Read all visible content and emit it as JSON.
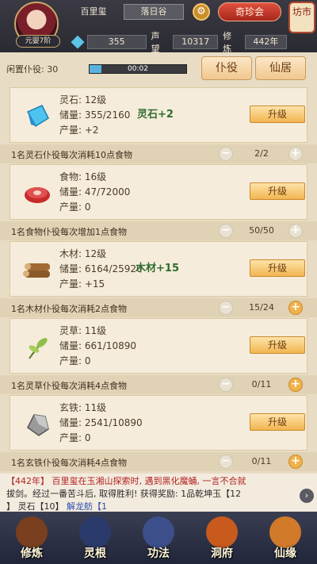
{
  "header": {
    "badge": "元婴7阶",
    "player_name": "百里玺",
    "location": "落日谷",
    "treasure_label": "奇珍会",
    "shop_label": "坊市",
    "gems": "355",
    "reputation_label": "声望",
    "reputation": "10317",
    "cultivation_label": "修炼",
    "cultivation_years": "442年"
  },
  "servants": {
    "label": "闲置仆役: 30",
    "timer": "00:02",
    "progress_fraction": 0.12,
    "tab_servant": "仆役",
    "tab_residence": "仙居"
  },
  "resources": [
    {
      "icon": "spirit-stone-icon",
      "name": "灵石: 12级",
      "storage": "储量: 355/2160",
      "output": "产量: +2",
      "float": "灵石+2",
      "upgrade": "升级",
      "worker_text": "1名灵石仆役每次消耗10点食物",
      "count": "2/2",
      "plus_active": false
    },
    {
      "icon": "food-icon",
      "name": "食物: 16级",
      "storage": "储量: 47/72000",
      "output": "产量: 0",
      "float": "",
      "upgrade": "升级",
      "worker_text": "1名食物仆役每次增加1点食物",
      "count": "50/50",
      "plus_active": false
    },
    {
      "icon": "wood-icon",
      "name": "木材: 12级",
      "storage": "储量: 6164/25920",
      "output": "产量: +15",
      "float": "木材+15",
      "upgrade": "升级",
      "worker_text": "1名木材仆役每次消耗2点食物",
      "count": "15/24",
      "plus_active": true
    },
    {
      "icon": "herb-icon",
      "name": "灵草: 11级",
      "storage": "储量: 661/10890",
      "output": "产量: 0",
      "float": "",
      "upgrade": "升级",
      "worker_text": "1名灵草仆役每次消耗4点食物",
      "count": "0/11",
      "plus_active": true
    },
    {
      "icon": "iron-icon",
      "name": "玄铁: 11级",
      "storage": "储量: 2541/10890",
      "output": "产量: 0",
      "float": "",
      "upgrade": "升级",
      "worker_text": "1名玄铁仆役每次消耗4点食物",
      "count": "0/11",
      "plus_active": true
    }
  ],
  "log": {
    "year": "【442年】",
    "line1": "百里玺在玉湘山探索时, 遇到黑化魔蛹, 一言不合就",
    "line2": "拔剑。经过一番苦斗后, 取得胜利! 获得奖励: 1品乾坤玉【12",
    "line3": "】 灵石【10】",
    "tail": "解龙舫【1"
  },
  "nav": [
    {
      "label": "修炼",
      "color": "#7a3f1e"
    },
    {
      "label": "灵根",
      "color": "#2a3a6a"
    },
    {
      "label": "功法",
      "color": "#3c4f8a"
    },
    {
      "label": "洞府",
      "color": "#c85a1e"
    },
    {
      "label": "仙缘",
      "color": "#d07a2a"
    }
  ]
}
